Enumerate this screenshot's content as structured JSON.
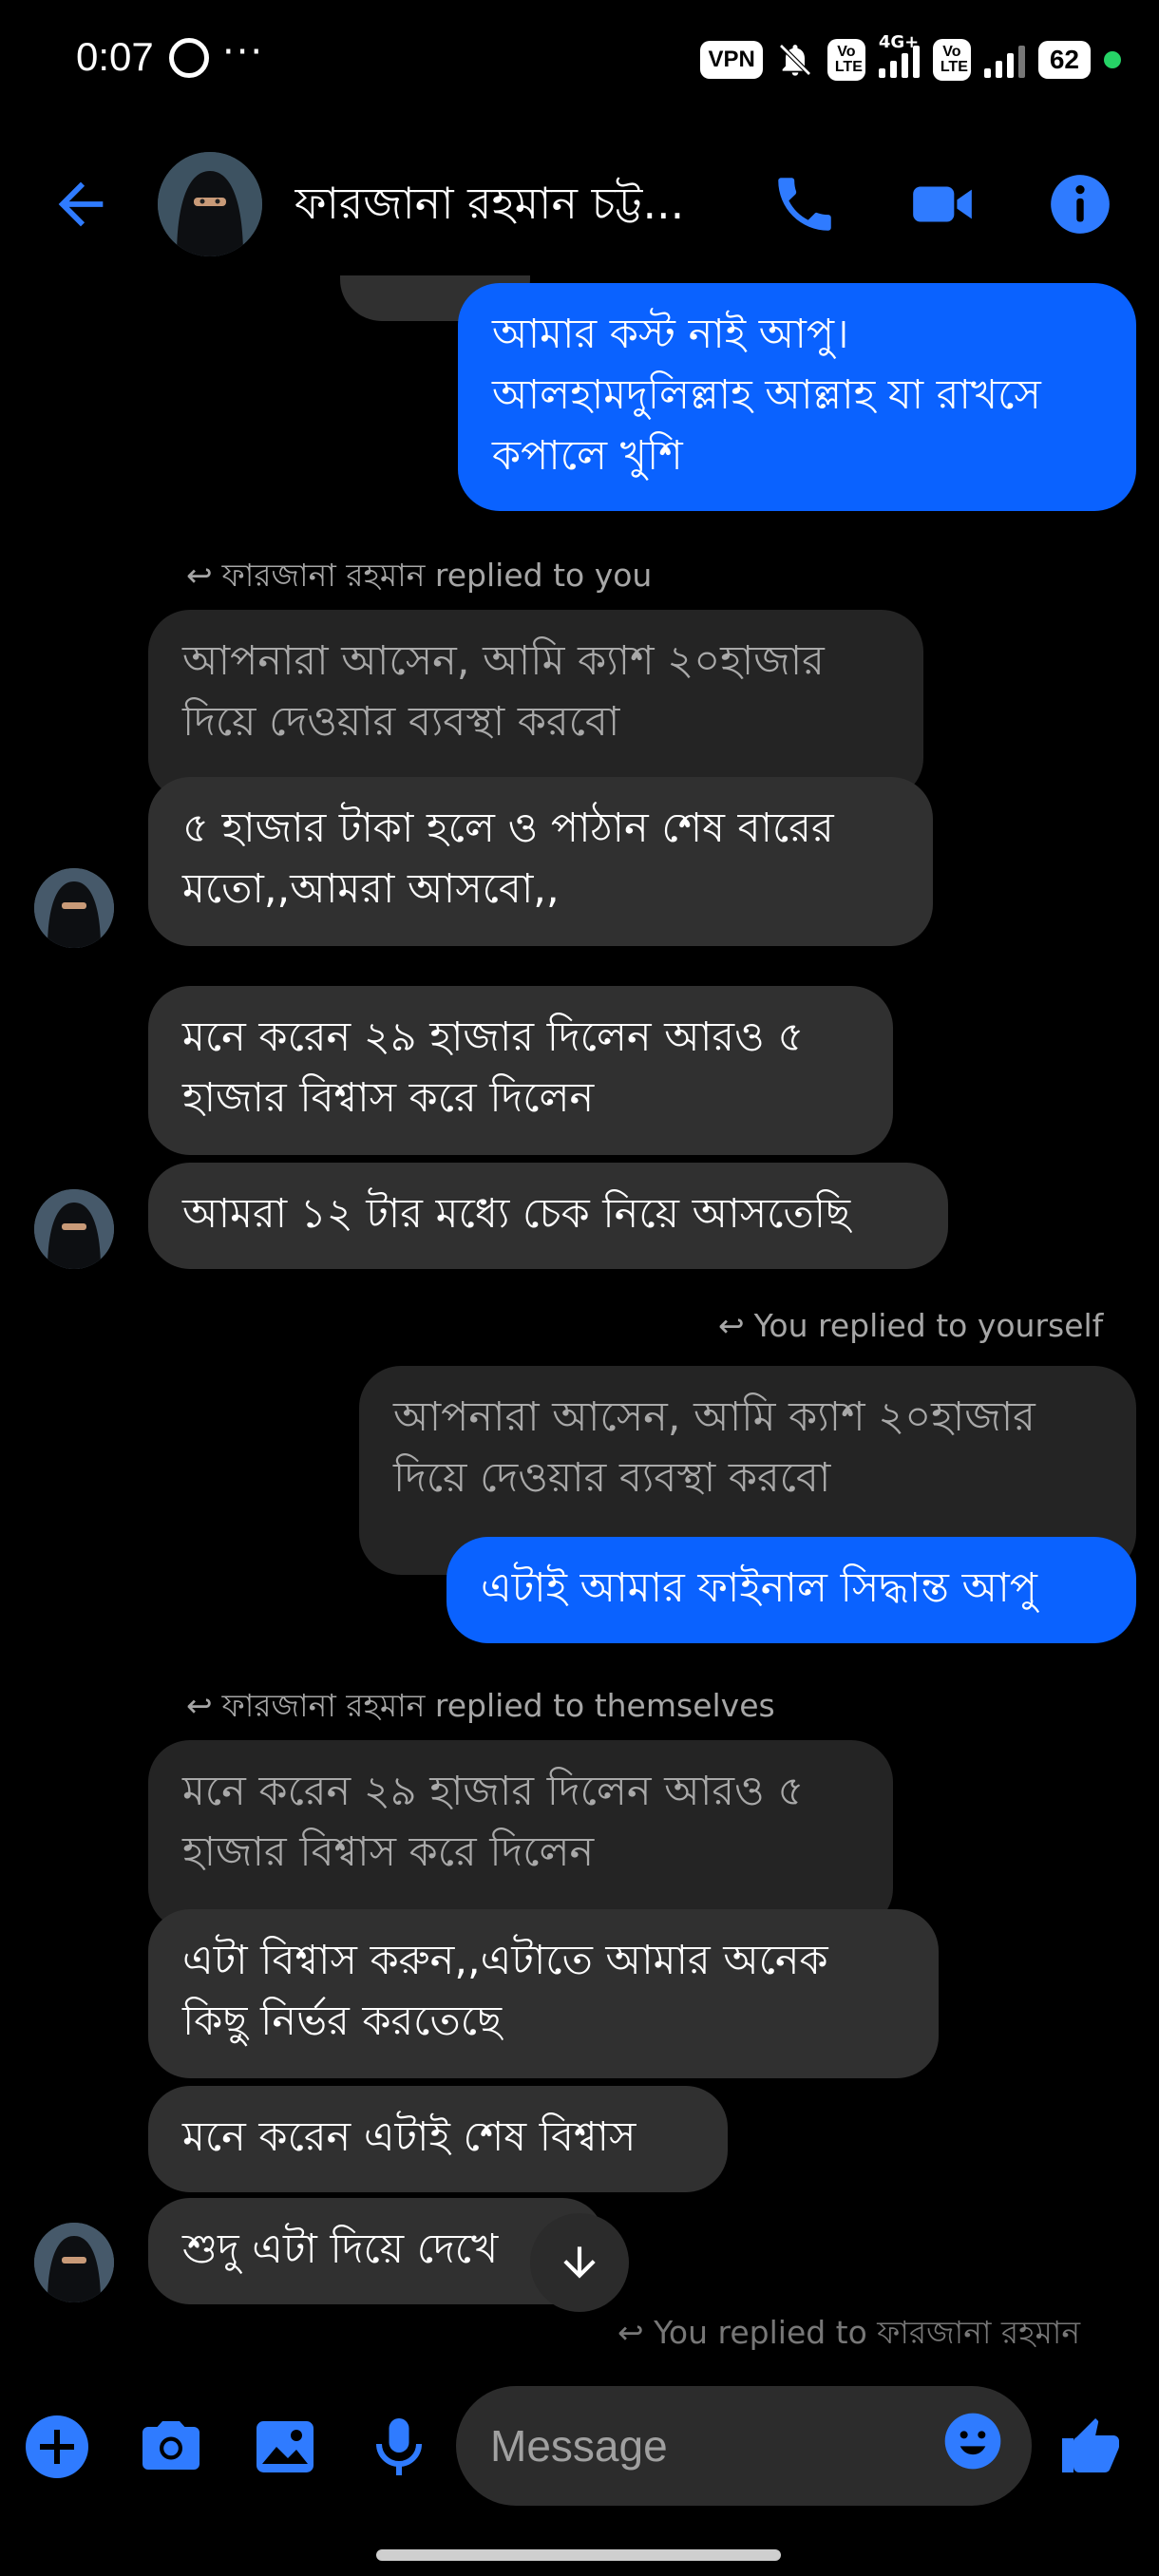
{
  "status_bar": {
    "time": "0:07",
    "dots": "···",
    "vpn": "VPN",
    "volte1": "Vo LTE",
    "net_type": "4G+",
    "volte2": "Vo LTE",
    "battery": "62"
  },
  "header": {
    "contact_name": "ফারজানা রহমান চট্ট..."
  },
  "messages": {
    "m1": "আমার কস্ট নাই আপু।\nআলহামদুলিল্লাহ আল্লাহ যা রাখসে কপালে খুশি",
    "r1_label": "ফারজানা রহমান replied to you",
    "r1_quote": "আপনারা আসেন, আমি ক্যাশ ২০হাজার দিয়ে দেওয়ার ব্যবস্থা করবো",
    "r1_text": "৫ হাজার টাকা হলে ও পাঠান শেষ বারের মতো,,আমরা আসবো,,",
    "m3": "মনে করেন ২৯ হাজার দিলেন আরও ৫ হাজার বিশ্বাস করে দিলেন",
    "m4": "আমরা ১২ টার মধ্যে চেক নিয়ে আসতেছি",
    "r2_label": "You replied to yourself",
    "r2_quote": "আপনারা আসেন, আমি ক্যাশ ২০হাজার দিয়ে দেওয়ার ব্যবস্থা করবো",
    "r2_text": "এটাই আমার ফাইনাল সিদ্ধান্ত আপু",
    "r3_label": "ফারজানা রহমান replied to themselves",
    "r3_quote": "মনে করেন ২৯ হাজার দিলেন আরও ৫ হাজার বিশ্বাস করে দিলেন",
    "r3_text": "এটা বিশ্বাস করুন,,এটাতে আমার অনেক কিছু নির্ভর করতেছে",
    "m7": "মনে করেন এটাই শেষ বিশ্বাস",
    "m8": "শুদু এটা দিয়ে দেখে",
    "faded_label": "You replied to ফারজানা রহমান"
  },
  "composer": {
    "placeholder": "Message"
  },
  "colors": {
    "accent": "#0a62ff",
    "icon_blue": "#2f7bff",
    "incoming_bubble": "#303030"
  }
}
